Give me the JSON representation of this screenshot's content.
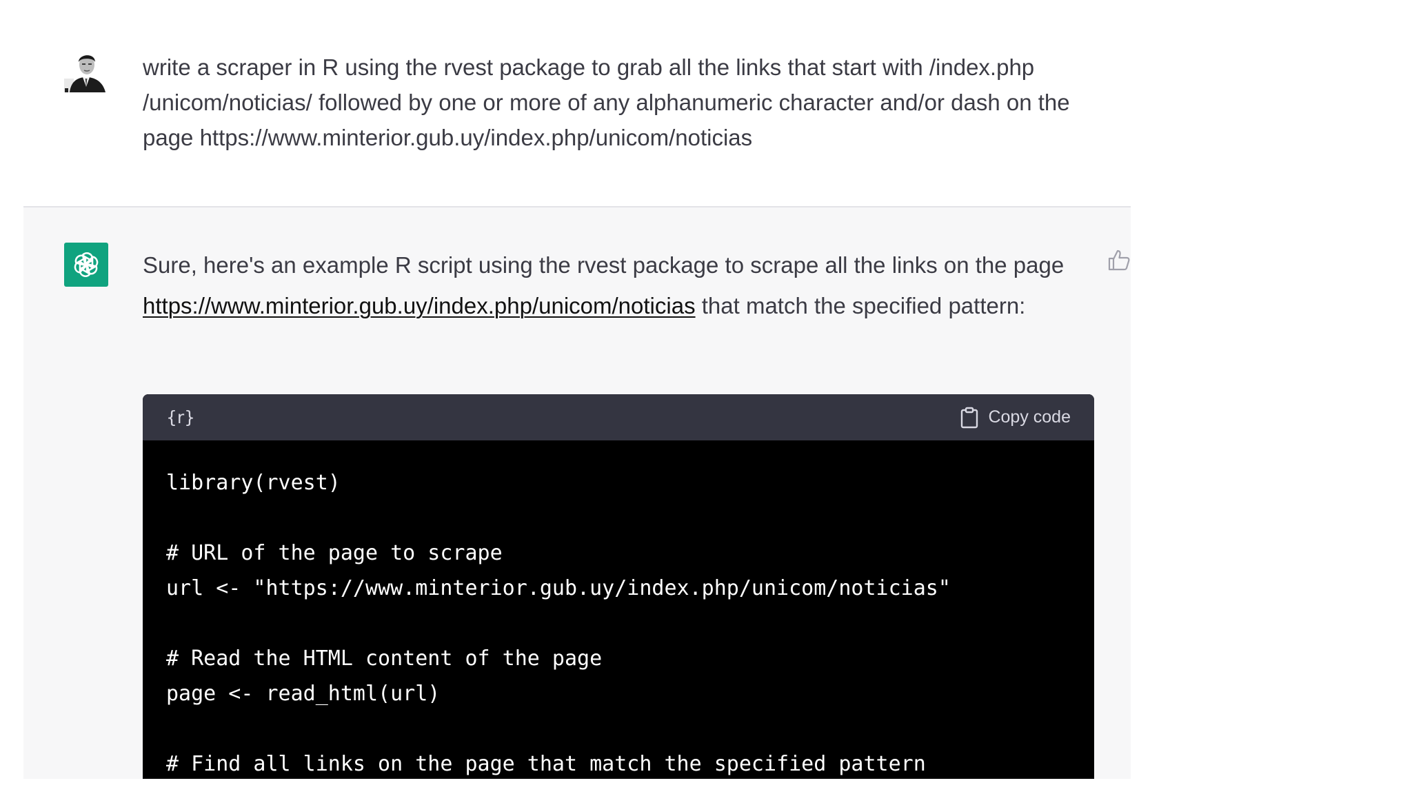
{
  "user_message": {
    "text": "write a scraper in R using the rvest package to grab all the links that start with /index.php /unicom/noticias/ followed by one or more of any alphanumeric character and/or dash on the page https://www.minterior.gub.uy/index.php/unicom/noticias",
    "avatar_icon": "user-avatar-photo"
  },
  "assistant_message": {
    "logo_icon": "openai-logo-icon",
    "intro_before_link": "Sure, here's an example R script using the rvest package to scrape all the links on the page ",
    "link_text": "https://www.minterior.gub.uy/index.php/unicom/noticias",
    "intro_after_link": " that match the specified pattern:",
    "thumb_icon": "thumbs-up-icon"
  },
  "code_block": {
    "language_label": "{r}",
    "copy_label": "Copy code",
    "lines": [
      "library(rvest)",
      "",
      "# URL of the page to scrape",
      "url <- \"https://www.minterior.gub.uy/index.php/unicom/noticias\"",
      "",
      "# Read the HTML content of the page",
      "page <- read_html(url)",
      "",
      "# Find all links on the page that match the specified pattern"
    ]
  },
  "colors": {
    "accent_green": "#10a37f",
    "code_header_bg": "#343541",
    "code_bg": "#000000",
    "assistant_bg": "#f7f7f8",
    "text": "#3b3b44"
  }
}
